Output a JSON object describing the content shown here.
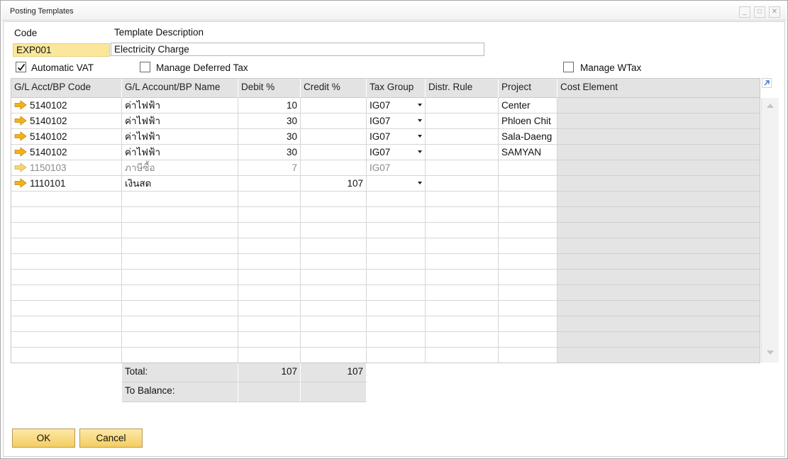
{
  "window": {
    "title": "Posting Templates",
    "minimize_glyph": "_",
    "maximize_glyph": "□",
    "close_glyph": "✕"
  },
  "header": {
    "code_label": "Code",
    "code_value": "EXP001",
    "description_label": "Template Description",
    "description_value": "Electricity Charge",
    "automatic_vat_label": "Automatic VAT",
    "automatic_vat_checked": true,
    "manage_deferred_tax_label": "Manage Deferred Tax",
    "manage_deferred_tax_checked": false,
    "manage_wtax_label": "Manage WTax",
    "manage_wtax_checked": false
  },
  "grid": {
    "columns": [
      "G/L Acct/BP Code",
      "G/L Account/BP Name",
      "Debit %",
      "Credit %",
      "Tax Group",
      "Distr. Rule",
      "Project",
      "Cost Element"
    ],
    "rows": [
      {
        "code": "5140102",
        "name": "ค่าไฟฟ้า",
        "debit": "10",
        "credit": "",
        "tax_group": "IG07",
        "distr_rule": "",
        "project": "Center",
        "cost_element": ""
      },
      {
        "code": "5140102",
        "name": "ค่าไฟฟ้า",
        "debit": "30",
        "credit": "",
        "tax_group": "IG07",
        "distr_rule": "",
        "project": "Phloen Chit",
        "cost_element": ""
      },
      {
        "code": "5140102",
        "name": "ค่าไฟฟ้า",
        "debit": "30",
        "credit": "",
        "tax_group": "IG07",
        "distr_rule": "",
        "project": "Sala-Daeng",
        "cost_element": ""
      },
      {
        "code": "5140102",
        "name": "ค่าไฟฟ้า",
        "debit": "30",
        "credit": "",
        "tax_group": "IG07",
        "distr_rule": "",
        "project": "SAMYAN",
        "cost_element": ""
      },
      {
        "code": "1150103",
        "name": "ภาษีซื้อ",
        "debit": "7",
        "credit": "",
        "tax_group": "IG07",
        "distr_rule": "",
        "project": "",
        "cost_element": ""
      },
      {
        "code": "1110101",
        "name": "เงินสด",
        "debit": "",
        "credit": "107",
        "tax_group": "",
        "distr_rule": "",
        "project": "",
        "cost_element": ""
      }
    ]
  },
  "totals": {
    "total_label": "Total:",
    "total_debit": "107",
    "total_credit": "107",
    "to_balance_label": "To Balance:",
    "to_balance_debit": "",
    "to_balance_credit": ""
  },
  "footer": {
    "ok_label": "OK",
    "cancel_label": "Cancel"
  },
  "colors": {
    "accent_yellow": "#fbe79b",
    "button_gradient_top": "#fde9a6",
    "button_gradient_bottom": "#f4cd63",
    "arrow_orange": "#f2b21b",
    "header_grey": "#e3e3e3"
  }
}
